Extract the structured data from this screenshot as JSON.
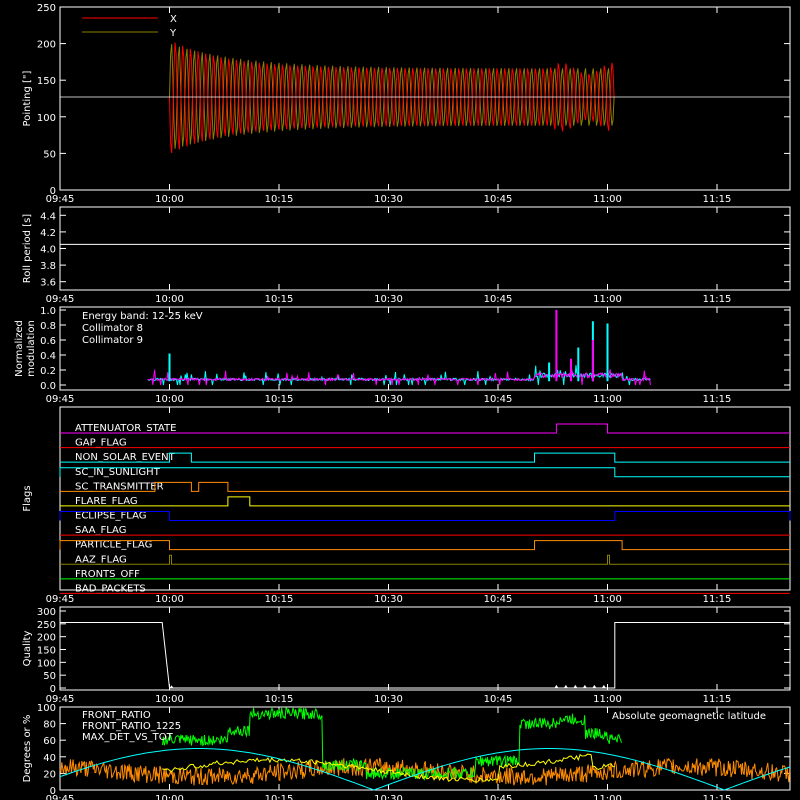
{
  "time_ticks": [
    "09:45",
    "10:00",
    "10:15",
    "10:30",
    "10:45",
    "11:00",
    "11:15"
  ],
  "chart_data": [
    {
      "type": "line",
      "ylabel": "Pointing [\"]",
      "yticks": [
        "0",
        "50",
        "100",
        "150",
        "200",
        "250"
      ],
      "ylim": [
        0,
        250
      ],
      "legend": [
        {
          "name": "X",
          "color": "#ff0000"
        },
        {
          "name": "Y",
          "color": "#8b8000"
        }
      ],
      "series": [
        {
          "name": "X",
          "color": "#ff0000",
          "center": 127,
          "amplitude_start": 80,
          "amplitude_mid": 40,
          "t_start": "10:00",
          "t_end": "11:01"
        },
        {
          "name": "Y",
          "color": "#8b8000",
          "center": 127,
          "amplitude_start": 75,
          "amplitude_mid": 40,
          "t_start": "10:00",
          "t_end": "11:01"
        }
      ],
      "reference_line": 127
    },
    {
      "type": "line",
      "ylabel": "Roll period [s]",
      "yticks": [
        "3.6",
        "3.8",
        "4.0",
        "4.2",
        "4.4"
      ],
      "ylim": [
        3.5,
        4.5
      ],
      "series": [
        {
          "name": "roll period",
          "value": 4.05,
          "color": "#ffffff"
        }
      ]
    },
    {
      "type": "line",
      "ylabel_lines": [
        "Normalized",
        "modulation"
      ],
      "yticks": [
        "0.0",
        "0.2",
        "0.4",
        "0.6",
        "0.8",
        "1.0"
      ],
      "ylim": [
        0,
        1.0
      ],
      "legend": [
        {
          "name": "Energy band: 12-25 keV",
          "color": "#ffffff"
        },
        {
          "name": "Collimator 8",
          "color": "#00ffff"
        },
        {
          "name": "Collimator 9",
          "color": "#ff00ff"
        }
      ],
      "series": [
        {
          "name": "Collimator 8",
          "color": "#00ffff",
          "spikes": [
            [
              "10:00",
              0.42
            ],
            [
              "10:52",
              0.3
            ],
            [
              "10:58",
              0.85
            ],
            [
              "11:00",
              0.82
            ],
            [
              "10:56",
              0.5
            ]
          ]
        },
        {
          "name": "Collimator 9",
          "color": "#ff00ff",
          "spikes": [
            [
              "10:53",
              1.0
            ],
            [
              "10:58",
              0.6
            ],
            [
              "10:55",
              0.35
            ]
          ]
        }
      ]
    },
    {
      "type": "table",
      "ylabel": "Flags",
      "flags": [
        {
          "name": "ATTENUATOR_STATE",
          "color": "#ff00ff",
          "high": [
            [
              "10:53",
              "11:00"
            ]
          ]
        },
        {
          "name": "GAP_FLAG",
          "color": "#ff0000",
          "high": []
        },
        {
          "name": "NON_SOLAR_EVENT",
          "color": "#00ffff",
          "high": [
            [
              "10:00",
              "10:03"
            ],
            [
              "10:50",
              "11:01"
            ]
          ]
        },
        {
          "name": "SC_IN_SUNLIGHT",
          "color": "#00ffff",
          "high": [
            [
              "09:45",
              "11:01"
            ]
          ]
        },
        {
          "name": "SC_TRANSMITTER",
          "color": "#ff8c00",
          "high": [
            [
              "09:58",
              "10:03"
            ],
            [
              "10:04",
              "10:08"
            ]
          ]
        },
        {
          "name": "FLARE_FLAG",
          "color": "#ffff00",
          "high": [
            [
              "10:08",
              "10:11"
            ]
          ]
        },
        {
          "name": "ECLIPSE_FLAG",
          "color": "#0000ff",
          "high": [
            [
              "09:45",
              "10:00"
            ],
            [
              "11:01",
              "11:25"
            ]
          ]
        },
        {
          "name": "SAA_FLAG",
          "color": "#ff0000",
          "high": []
        },
        {
          "name": "PARTICLE_FLAG",
          "color": "#ff8c00",
          "high": [
            [
              "09:45",
              "10:00"
            ],
            [
              "10:50",
              "11:02"
            ]
          ]
        },
        {
          "name": "AAZ_FLAG",
          "color": "#8b8000",
          "high": [
            [
              "10:00",
              "10:00"
            ],
            [
              "11:00",
              "11:00"
            ]
          ]
        },
        {
          "name": "FRONTS_OFF",
          "color": "#00ff00",
          "high": []
        },
        {
          "name": "BAD_PACKETS",
          "color": "#ff0000",
          "high": []
        }
      ]
    },
    {
      "type": "line",
      "ylabel": "Quality",
      "yticks": [
        "0",
        "50",
        "100",
        "150",
        "200",
        "250",
        "300"
      ],
      "ylim": [
        0,
        300
      ],
      "series": [
        {
          "name": "Quality",
          "color": "#ffffff",
          "segments": [
            [
              "09:45",
              255
            ],
            [
              "09:59",
              255
            ],
            [
              "10:00",
              0
            ],
            [
              "11:01",
              0
            ],
            [
              "11:01",
              255
            ],
            [
              "11:25",
              255
            ]
          ]
        }
      ]
    },
    {
      "type": "line",
      "ylabel": "Degrees or %",
      "yticks": [
        "0",
        "20",
        "40",
        "60",
        "80",
        "100"
      ],
      "ylim": [
        0,
        100
      ],
      "legend": [
        {
          "name": "FRONT_RATIO",
          "color": "#ffff00"
        },
        {
          "name": "FRONT_RATIO_1225",
          "color": "#00ff00"
        },
        {
          "name": "MAX_DET_VS_TOT",
          "color": "#ff8c00"
        }
      ],
      "annotation": {
        "text": "Absolute geomagnetic latitude",
        "color": "#00ffff"
      },
      "series": [
        {
          "name": "FRONT_RATIO",
          "color": "#ffff00"
        },
        {
          "name": "FRONT_RATIO_1225",
          "color": "#00ff00"
        },
        {
          "name": "MAX_DET_VS_TOT",
          "color": "#ff8c00"
        },
        {
          "name": "Absolute geomagnetic latitude",
          "color": "#00ffff"
        }
      ]
    }
  ]
}
